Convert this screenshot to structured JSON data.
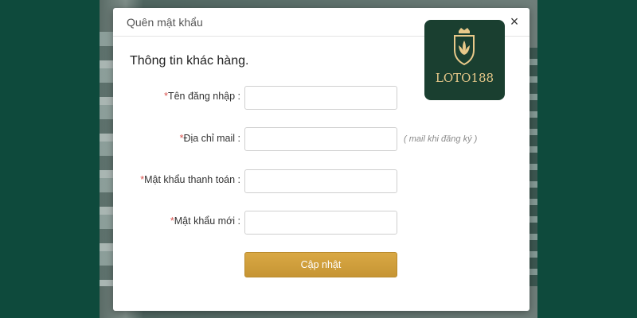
{
  "dialog": {
    "title": "Quên mật khẩu",
    "close_glyph": "×",
    "section_title": "Thông tin khác hàng.",
    "fields": [
      {
        "required_mark": "*",
        "label": "Tên đăng nhập :",
        "value": "",
        "placeholder": ""
      },
      {
        "required_mark": "*",
        "label": "Địa chỉ mail :",
        "value": "",
        "placeholder": ""
      },
      {
        "required_mark": "*",
        "label": "Mật khẩu thanh toán :",
        "value": "",
        "placeholder": ""
      },
      {
        "required_mark": "*",
        "label": "Mật khẩu mới :",
        "value": "",
        "placeholder": ""
      }
    ],
    "email_hint": "( mail khi đăng ký )",
    "submit_label": "Cập nhật"
  },
  "logo": {
    "text": "LOTO188",
    "icon": "lotus-crest-icon"
  },
  "colors": {
    "backdrop": "#0e4a3c",
    "accent_button": "#c99a3a",
    "required": "#d9534f",
    "logo_bg": "#1a3f30",
    "logo_gold": "#e8c98a"
  }
}
